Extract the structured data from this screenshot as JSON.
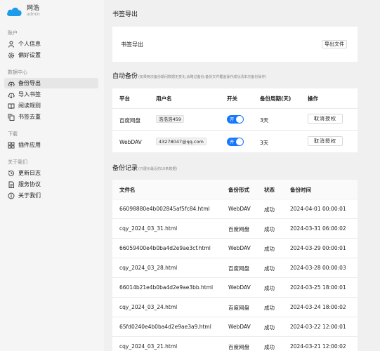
{
  "brand": {
    "name": "网浩",
    "role": "admin",
    "logo_icon": "cloud-icon",
    "logo_color": "#1e9be9"
  },
  "nav": {
    "sections": [
      {
        "label": "账户",
        "items": [
          {
            "label": "个人信息",
            "icon": "user-icon"
          },
          {
            "label": "偏好设置",
            "icon": "gear-icon"
          }
        ]
      },
      {
        "label": "数据中心",
        "items": [
          {
            "label": "备份导出",
            "icon": "cloud-upload-icon",
            "active": true
          },
          {
            "label": "导入书签",
            "icon": "cloud-download-icon"
          },
          {
            "label": "阅读规则",
            "icon": "book-icon"
          },
          {
            "label": "书签去重",
            "icon": "copy-icon"
          }
        ]
      },
      {
        "label": "下载",
        "items": [
          {
            "label": "插件应用",
            "icon": "apps-icon"
          }
        ]
      },
      {
        "label": "关于我们",
        "items": [
          {
            "label": "更新日志",
            "icon": "history-icon"
          },
          {
            "label": "服务协议",
            "icon": "document-icon"
          },
          {
            "label": "关于我们",
            "icon": "info-icon"
          }
        ]
      }
    ]
  },
  "page": {
    "title": "书签导出",
    "export_card": {
      "label": "书签导出",
      "button": "导出文件"
    },
    "auto_backup": {
      "title": "自动备份",
      "hint": "(如果两次备份期间数据无变化,会略过备份;备份文件覆盖操作成功清本次备份操作)",
      "columns": [
        "平台",
        "用户名",
        "开关",
        "备份周期(天)",
        "操作"
      ],
      "rows": [
        {
          "platform": "百度网盘",
          "username": "浩浩浩459",
          "toggle": "开",
          "period": "3天",
          "action": "取消授权"
        },
        {
          "platform": "WebDAV",
          "username": "43278047@qq.com",
          "toggle": "开",
          "period": "3天",
          "action": "取消授权"
        }
      ],
      "accent": "#1677ff"
    },
    "records": {
      "title": "备份记录",
      "hint": "(只展示最近的10条数据)",
      "columns": [
        "文件名",
        "备份形式",
        "状态",
        "备份时间"
      ],
      "rows": [
        {
          "file": "66098880e4b002845af5fc84.html",
          "type": "WebDAV",
          "status": "成功",
          "time": "2024-04-01 00:00:01"
        },
        {
          "file": "cqy_2024_03_31.html",
          "type": "百度网盘",
          "status": "成功",
          "time": "2024-03-31 06:00:02"
        },
        {
          "file": "66059400e4b0ba4d2e9ae3cf.html",
          "type": "WebDAV",
          "status": "成功",
          "time": "2024-03-29 00:00:01"
        },
        {
          "file": "cqy_2024_03_28.html",
          "type": "百度网盘",
          "status": "成功",
          "time": "2024-03-28 00:00:03"
        },
        {
          "file": "66014b21e4b0ba4d2e9ae3bb.html",
          "type": "WebDAV",
          "status": "成功",
          "time": "2024-03-25 18:00:01"
        },
        {
          "file": "cqy_2024_03_24.html",
          "type": "百度网盘",
          "status": "成功",
          "time": "2024-03-24 18:00:02"
        },
        {
          "file": "65fd0240e4b0ba4d2e9ae3a9.html",
          "type": "WebDAV",
          "status": "成功",
          "time": "2024-03-22 12:00:01"
        },
        {
          "file": "cqy_2024_03_21.html",
          "type": "百度网盘",
          "status": "成功",
          "time": "2024-03-21 12:00:02"
        }
      ]
    }
  }
}
